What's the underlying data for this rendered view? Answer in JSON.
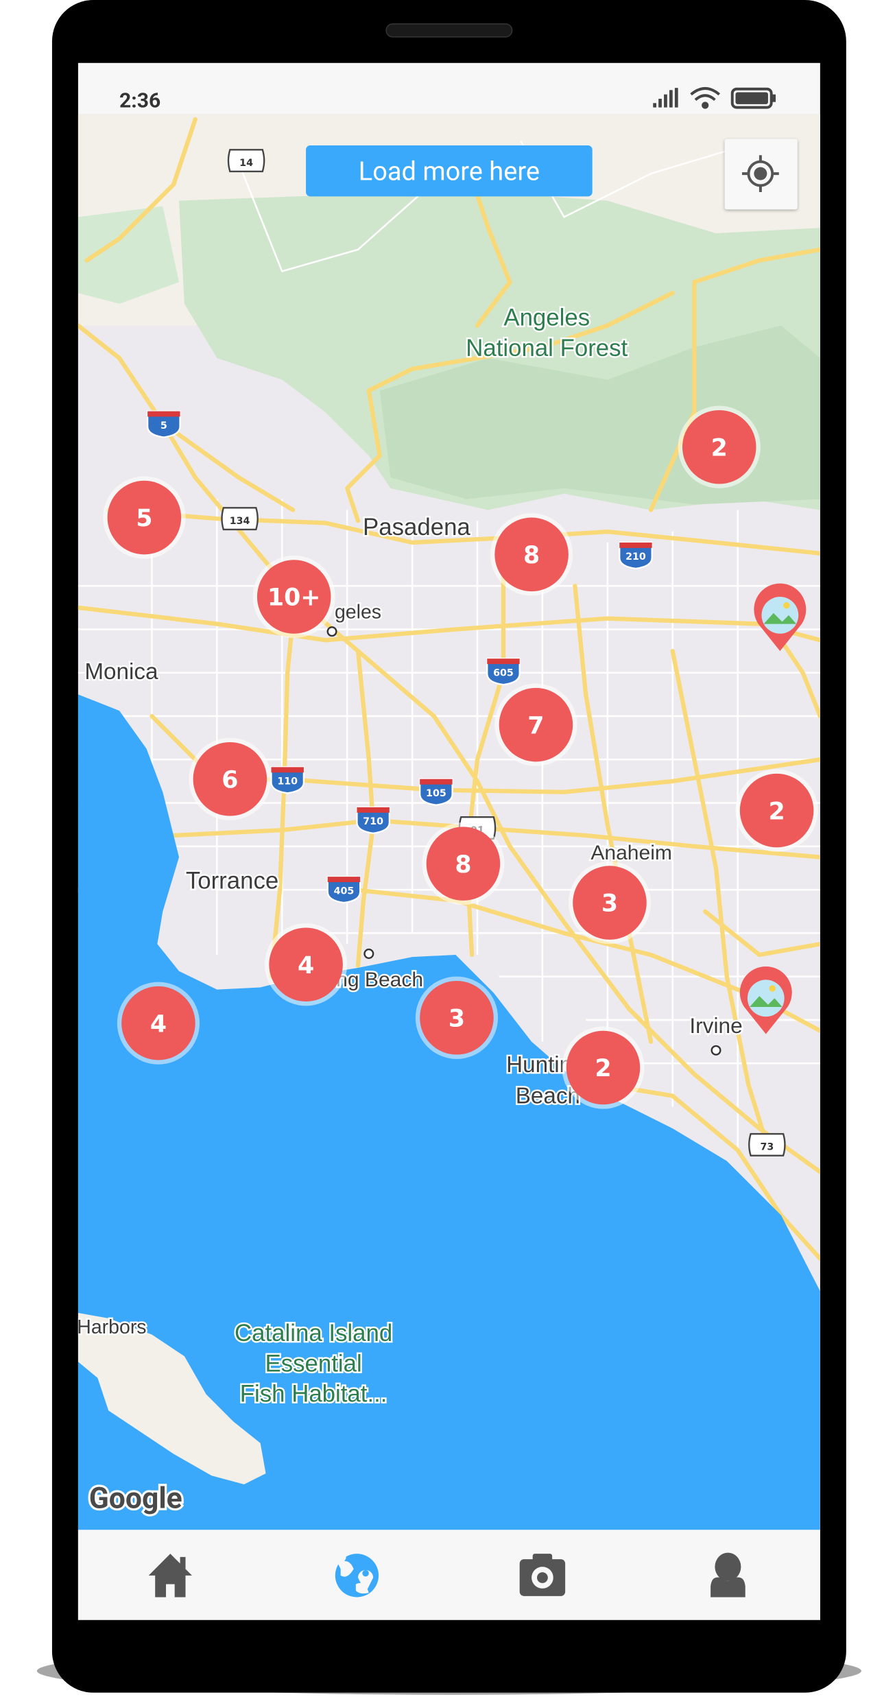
{
  "status_bar": {
    "time": "2:36",
    "icons": [
      "signal-icon",
      "wifi-icon",
      "battery-icon"
    ]
  },
  "map": {
    "load_more_label": "Load more here",
    "locate_icon": "my-location-icon",
    "place_labels": {
      "forest_line1": "Angeles",
      "forest_line2": "National Forest",
      "pasadena": "Pasadena",
      "los_angeles": "geles",
      "monica": "Monica",
      "torrance": "Torrance",
      "anaheim": "Anaheim",
      "long_beach": "ng Beach",
      "huntington_1": "Huntin",
      "huntington_2": "Beach",
      "irvine": "Irvine",
      "harbors": "Harbors",
      "catalina_1": "Catalina Island",
      "catalina_2": "Essential",
      "catalina_3": "Fish Habitat..."
    },
    "highway_shields": [
      "14",
      "5",
      "134",
      "210",
      "605",
      "110",
      "105",
      "710",
      "405",
      "73",
      "91"
    ],
    "clusters": [
      "2",
      "5",
      "8",
      "10+",
      "7",
      "6",
      "2",
      "8",
      "3",
      "4",
      "4",
      "3",
      "2"
    ],
    "marker_color": "#ee5a5a",
    "water_color": "#3ba9fb",
    "google_logo": "Google"
  },
  "bottom_nav": {
    "items": [
      {
        "icon": "home-icon",
        "active": false
      },
      {
        "icon": "globe-location-icon",
        "active": true
      },
      {
        "icon": "camera-icon",
        "active": false
      },
      {
        "icon": "person-icon",
        "active": false
      }
    ],
    "active_color": "#3ba9fb",
    "inactive_color": "#555555"
  }
}
